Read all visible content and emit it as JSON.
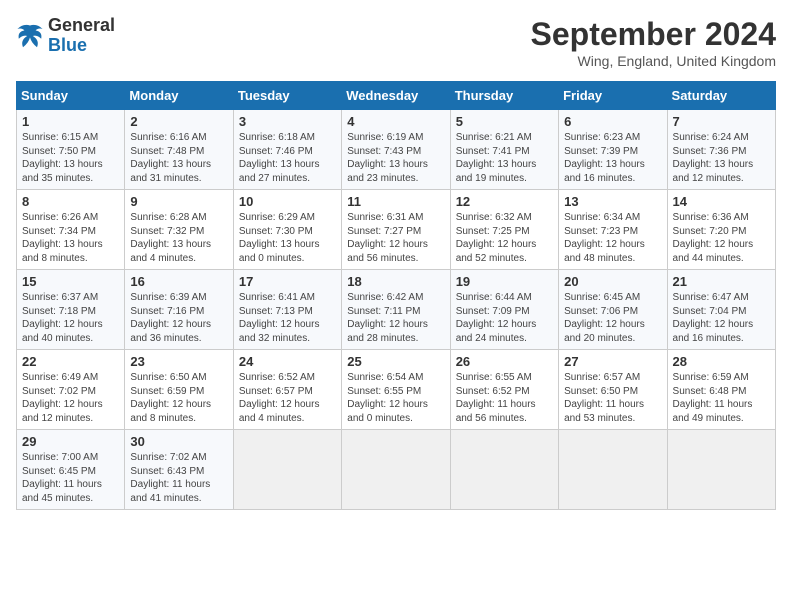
{
  "logo": {
    "general": "General",
    "blue": "Blue"
  },
  "header": {
    "month": "September 2024",
    "location": "Wing, England, United Kingdom"
  },
  "days_of_week": [
    "Sunday",
    "Monday",
    "Tuesday",
    "Wednesday",
    "Thursday",
    "Friday",
    "Saturday"
  ],
  "weeks": [
    [
      {
        "day": "1",
        "sunrise": "6:15 AM",
        "sunset": "7:50 PM",
        "daylight": "13 hours and 35 minutes."
      },
      {
        "day": "2",
        "sunrise": "6:16 AM",
        "sunset": "7:48 PM",
        "daylight": "13 hours and 31 minutes."
      },
      {
        "day": "3",
        "sunrise": "6:18 AM",
        "sunset": "7:46 PM",
        "daylight": "13 hours and 27 minutes."
      },
      {
        "day": "4",
        "sunrise": "6:19 AM",
        "sunset": "7:43 PM",
        "daylight": "13 hours and 23 minutes."
      },
      {
        "day": "5",
        "sunrise": "6:21 AM",
        "sunset": "7:41 PM",
        "daylight": "13 hours and 19 minutes."
      },
      {
        "day": "6",
        "sunrise": "6:23 AM",
        "sunset": "7:39 PM",
        "daylight": "13 hours and 16 minutes."
      },
      {
        "day": "7",
        "sunrise": "6:24 AM",
        "sunset": "7:36 PM",
        "daylight": "13 hours and 12 minutes."
      }
    ],
    [
      {
        "day": "8",
        "sunrise": "6:26 AM",
        "sunset": "7:34 PM",
        "daylight": "13 hours and 8 minutes."
      },
      {
        "day": "9",
        "sunrise": "6:28 AM",
        "sunset": "7:32 PM",
        "daylight": "13 hours and 4 minutes."
      },
      {
        "day": "10",
        "sunrise": "6:29 AM",
        "sunset": "7:30 PM",
        "daylight": "13 hours and 0 minutes."
      },
      {
        "day": "11",
        "sunrise": "6:31 AM",
        "sunset": "7:27 PM",
        "daylight": "12 hours and 56 minutes."
      },
      {
        "day": "12",
        "sunrise": "6:32 AM",
        "sunset": "7:25 PM",
        "daylight": "12 hours and 52 minutes."
      },
      {
        "day": "13",
        "sunrise": "6:34 AM",
        "sunset": "7:23 PM",
        "daylight": "12 hours and 48 minutes."
      },
      {
        "day": "14",
        "sunrise": "6:36 AM",
        "sunset": "7:20 PM",
        "daylight": "12 hours and 44 minutes."
      }
    ],
    [
      {
        "day": "15",
        "sunrise": "6:37 AM",
        "sunset": "7:18 PM",
        "daylight": "12 hours and 40 minutes."
      },
      {
        "day": "16",
        "sunrise": "6:39 AM",
        "sunset": "7:16 PM",
        "daylight": "12 hours and 36 minutes."
      },
      {
        "day": "17",
        "sunrise": "6:41 AM",
        "sunset": "7:13 PM",
        "daylight": "12 hours and 32 minutes."
      },
      {
        "day": "18",
        "sunrise": "6:42 AM",
        "sunset": "7:11 PM",
        "daylight": "12 hours and 28 minutes."
      },
      {
        "day": "19",
        "sunrise": "6:44 AM",
        "sunset": "7:09 PM",
        "daylight": "12 hours and 24 minutes."
      },
      {
        "day": "20",
        "sunrise": "6:45 AM",
        "sunset": "7:06 PM",
        "daylight": "12 hours and 20 minutes."
      },
      {
        "day": "21",
        "sunrise": "6:47 AM",
        "sunset": "7:04 PM",
        "daylight": "12 hours and 16 minutes."
      }
    ],
    [
      {
        "day": "22",
        "sunrise": "6:49 AM",
        "sunset": "7:02 PM",
        "daylight": "12 hours and 12 minutes."
      },
      {
        "day": "23",
        "sunrise": "6:50 AM",
        "sunset": "6:59 PM",
        "daylight": "12 hours and 8 minutes."
      },
      {
        "day": "24",
        "sunrise": "6:52 AM",
        "sunset": "6:57 PM",
        "daylight": "12 hours and 4 minutes."
      },
      {
        "day": "25",
        "sunrise": "6:54 AM",
        "sunset": "6:55 PM",
        "daylight": "12 hours and 0 minutes."
      },
      {
        "day": "26",
        "sunrise": "6:55 AM",
        "sunset": "6:52 PM",
        "daylight": "11 hours and 56 minutes."
      },
      {
        "day": "27",
        "sunrise": "6:57 AM",
        "sunset": "6:50 PM",
        "daylight": "11 hours and 53 minutes."
      },
      {
        "day": "28",
        "sunrise": "6:59 AM",
        "sunset": "6:48 PM",
        "daylight": "11 hours and 49 minutes."
      }
    ],
    [
      {
        "day": "29",
        "sunrise": "7:00 AM",
        "sunset": "6:45 PM",
        "daylight": "11 hours and 45 minutes."
      },
      {
        "day": "30",
        "sunrise": "7:02 AM",
        "sunset": "6:43 PM",
        "daylight": "11 hours and 41 minutes."
      },
      null,
      null,
      null,
      null,
      null
    ]
  ]
}
